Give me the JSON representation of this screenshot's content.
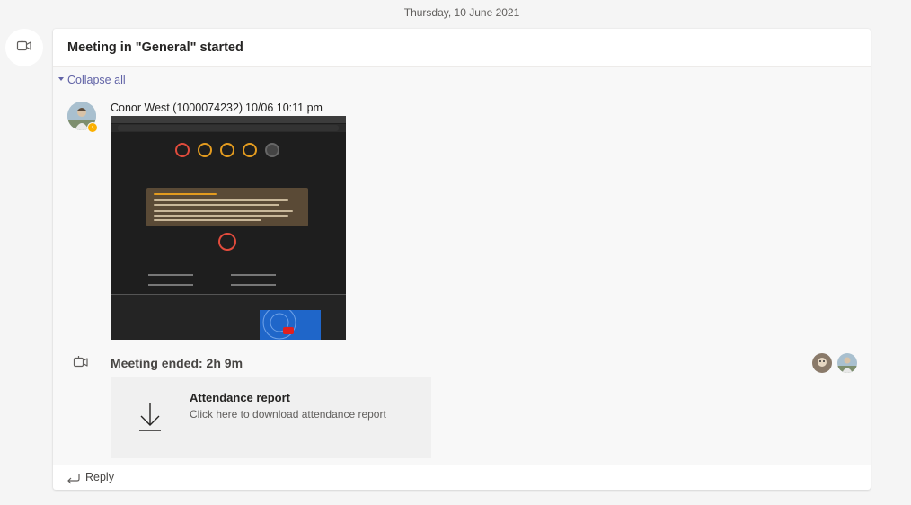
{
  "date_divider": {
    "text": "Thursday, 10 June 2021"
  },
  "card": {
    "title": "Meeting in \"General\" started",
    "collapse_label": "Collapse all"
  },
  "message": {
    "author": "Conor West (1000074232)",
    "timestamp": "10/06 10:11 pm",
    "attachment_icon": "screenshot-image",
    "status": "away"
  },
  "meeting_end": {
    "title": "Meeting ended: 2h 9m",
    "participant_count": 2
  },
  "attendance": {
    "title": "Attendance report",
    "subtitle": "Click here to download attendance report",
    "icon": "download-icon"
  },
  "reply": {
    "label": "Reply",
    "icon": "reply-arrow-icon"
  },
  "colors": {
    "accent": "#6264a7",
    "background": "#f5f5f5",
    "card": "#ffffff",
    "attendance_bg": "#f0f0f0",
    "away_status": "#fbb000"
  }
}
